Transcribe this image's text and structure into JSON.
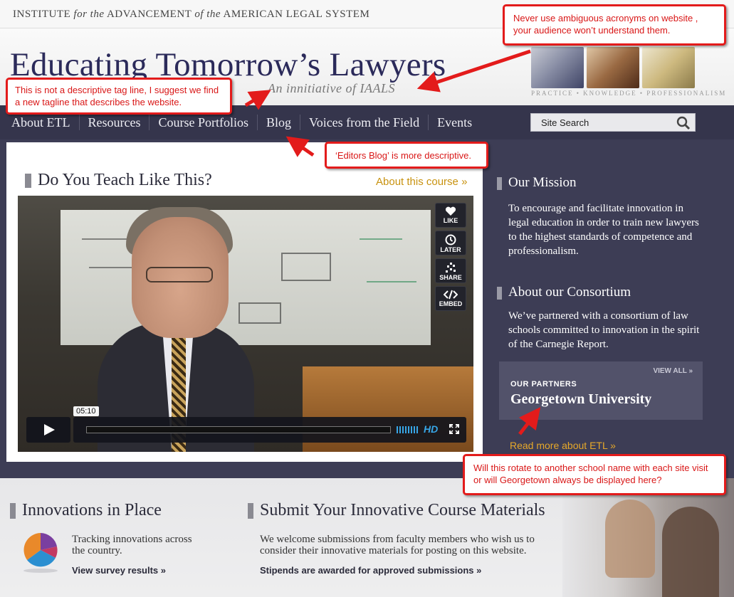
{
  "top": {
    "institute_prefix": "INSTITUTE",
    "institute_for": "for the",
    "institute_mid": "ADVANCEMENT",
    "institute_of": "of the",
    "institute_end": "AMERICAN LEGAL SYSTEM"
  },
  "header": {
    "title": "Educating Tomorrow’s Lawyers",
    "tagline": "An innitiative of IAALS",
    "logo_caption": "PRACTICE • KNOWLEDGE • PROFESSIONALISM"
  },
  "nav": {
    "items": [
      "About ETL",
      "Resources",
      "Course Portfolios",
      "Blog",
      "Voices from the Field",
      "Events"
    ],
    "search_placeholder": "Site Search"
  },
  "main": {
    "heading": "Do You Teach Like This?",
    "about_link": "About this course »",
    "video": {
      "buttons": [
        "LIKE",
        "LATER",
        "SHARE",
        "EMBED"
      ],
      "timecode": "05:10",
      "hd_label": "HD"
    }
  },
  "sidebar": {
    "mission_heading": "Our Mission",
    "mission_text": "To encourage and facilitate innovation in legal education in order to train new lawyers to the highest standards of competence and professionalism.",
    "consortium_heading": "About our Consortium",
    "consortium_text": "We’ve partnered with a consortium of law schools committed to innovation in the spirit of the Carnegie Report.",
    "partners_view_all": "VIEW ALL »",
    "partners_label": "OUR PARTNERS",
    "partner_name": "Georgetown University",
    "read_more": "Read more about ETL »"
  },
  "lower": {
    "innovations_heading": "Innovations in Place",
    "innovations_text": "Tracking innovations across the country.",
    "innovations_link": "View survey results »",
    "submit_heading": "Submit Your Innovative Course Materials",
    "submit_text": "We welcome submissions from faculty members who wish us to consider their innovative materials for posting on this website.",
    "submit_link": "Stipends are awarded for approved submissions »"
  },
  "annotations": {
    "acronym": "Never use ambiguous acronyms  on website , your audience won’t understand  them.",
    "tagline": "This is not a descriptive tag line,  I suggest we find a new tagline that describes the website.",
    "blog": "‘Editors Blog’ is more descriptive.",
    "rotate": "Will this rotate to another school name with each site visit or will Georgetown always be displayed here?"
  },
  "colors": {
    "nav_bg": "#35354c",
    "band_bg": "#3d3d55",
    "accent_gold": "#c8920f",
    "annotation_red": "#e31b1b",
    "video_blue": "#37a6e6"
  }
}
